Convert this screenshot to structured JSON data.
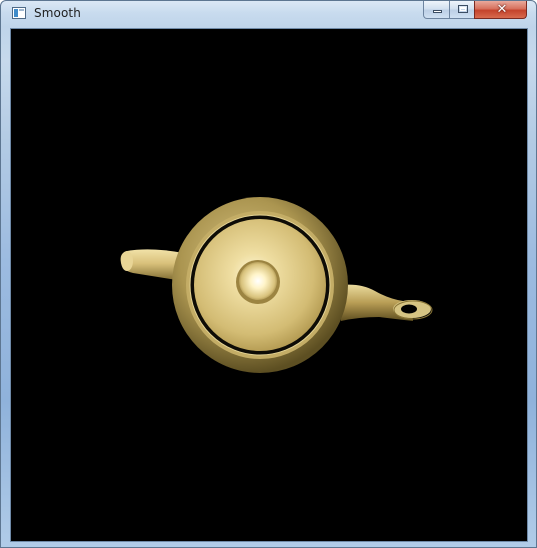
{
  "window": {
    "title": "Smooth",
    "app_icon": "opengl-window-icon",
    "caption_buttons": {
      "minimize_icon": "minimize-icon",
      "maximize_icon": "maximize-icon",
      "close_icon": "close-icon"
    }
  },
  "canvas": {
    "background": "#000000",
    "scene": "teapot-top-view",
    "material_color": "#c8b06a"
  }
}
